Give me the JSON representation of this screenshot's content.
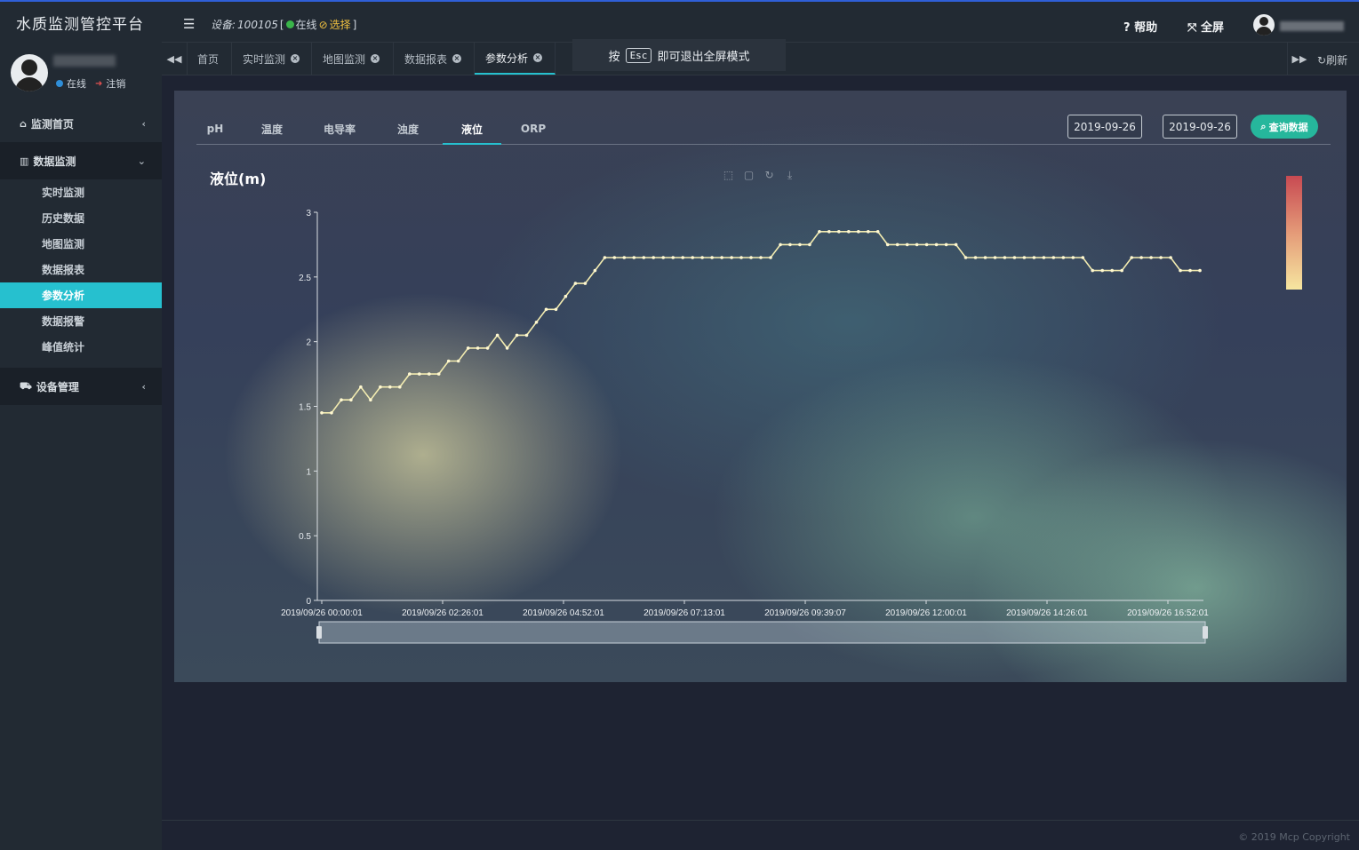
{
  "app": {
    "title": "水质监测管控平台"
  },
  "user": {
    "status": "在线",
    "logout": "注销"
  },
  "sidebar": {
    "groups": [
      {
        "label": "监测首页",
        "icon": "home-icon"
      },
      {
        "label": "数据监测",
        "icon": "bar-chart-icon"
      },
      {
        "label": "设备管理",
        "icon": "car-icon"
      }
    ],
    "items": [
      {
        "label": "实时监测"
      },
      {
        "label": "历史数据"
      },
      {
        "label": "地图监测"
      },
      {
        "label": "数据报表"
      },
      {
        "label": "参数分析",
        "active": true
      },
      {
        "label": "数据报警"
      },
      {
        "label": "峰值统计"
      }
    ]
  },
  "topbar": {
    "device_label": "设备:",
    "device_id": "100105",
    "device_status": "在线",
    "select_label": "选择",
    "help": "帮助",
    "fullscreen": "全屏"
  },
  "tabs": [
    {
      "label": "首页",
      "closable": false
    },
    {
      "label": "实时监测",
      "closable": true
    },
    {
      "label": "地图监测",
      "closable": true
    },
    {
      "label": "数据报表",
      "closable": true
    },
    {
      "label": "参数分析",
      "closable": true,
      "active": true
    }
  ],
  "esc_tip": {
    "prefix": "按",
    "key": "Esc",
    "suffix": "即可退出全屏模式"
  },
  "refresh": "刷新",
  "param_tabs": [
    {
      "label": "pH"
    },
    {
      "label": "温度"
    },
    {
      "label": "电导率"
    },
    {
      "label": "浊度"
    },
    {
      "label": "液位",
      "active": true
    },
    {
      "label": "ORP"
    }
  ],
  "query": {
    "start_date": "2019-09-26",
    "end_date": "2019-09-26",
    "button": "查询数据"
  },
  "colors": {
    "accent": "#26c0cf",
    "query_button": "#26b79c",
    "line": "#f3ecb0",
    "online": "#3ab54a"
  },
  "chart_data": {
    "type": "line",
    "title": "液位(m)",
    "ylim": [
      0,
      3
    ],
    "yticks": [
      "0",
      "0.5",
      "1",
      "1.5",
      "2",
      "2.5",
      "3"
    ],
    "xtick_labels": [
      "2019/09/26 00:00:01",
      "2019/09/26 02:26:01",
      "2019/09/26 04:52:01",
      "2019/09/26 07:13:01",
      "2019/09/26 09:39:07",
      "2019/09/26 12:00:01",
      "2019/09/26 14:26:01",
      "2019/09/26 16:52:01"
    ],
    "grid": false,
    "visual_map": "right",
    "data_zoom": "bottom",
    "values": [
      1.45,
      1.45,
      1.55,
      1.55,
      1.65,
      1.55,
      1.65,
      1.65,
      1.65,
      1.75,
      1.75,
      1.75,
      1.75,
      1.85,
      1.85,
      1.95,
      1.95,
      1.95,
      2.05,
      1.95,
      2.05,
      2.05,
      2.15,
      2.25,
      2.25,
      2.35,
      2.45,
      2.45,
      2.55,
      2.65,
      2.65,
      2.65,
      2.65,
      2.65,
      2.65,
      2.65,
      2.65,
      2.65,
      2.65,
      2.65,
      2.65,
      2.65,
      2.65,
      2.65,
      2.65,
      2.65,
      2.65,
      2.75,
      2.75,
      2.75,
      2.75,
      2.85,
      2.85,
      2.85,
      2.85,
      2.85,
      2.85,
      2.85,
      2.75,
      2.75,
      2.75,
      2.75,
      2.75,
      2.75,
      2.75,
      2.75,
      2.65,
      2.65,
      2.65,
      2.65,
      2.65,
      2.65,
      2.65,
      2.65,
      2.65,
      2.65,
      2.65,
      2.65,
      2.65,
      2.55,
      2.55,
      2.55,
      2.55,
      2.65,
      2.65,
      2.65,
      2.65,
      2.65,
      2.55,
      2.55,
      2.55
    ]
  },
  "footer": {
    "copyright": "© 2019 Mcp Copyright"
  }
}
